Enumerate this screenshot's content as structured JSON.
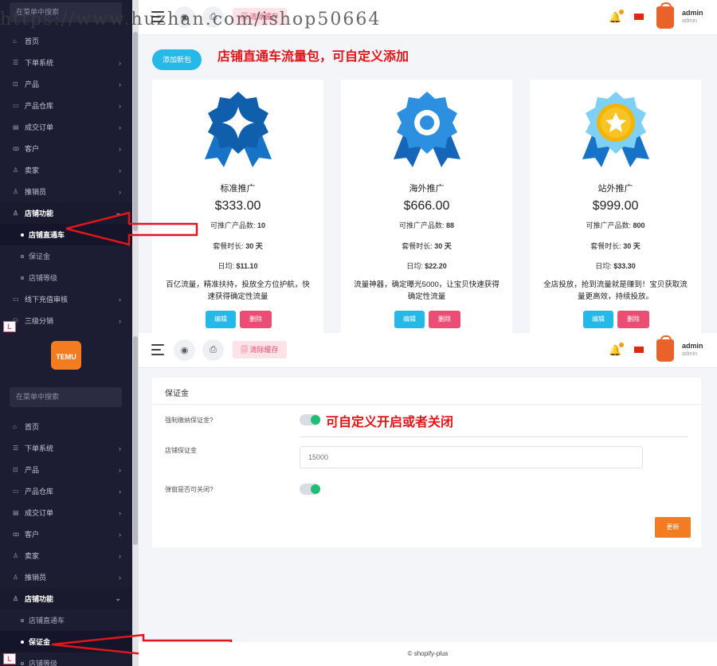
{
  "watermark": "https://www.huzhan.com/ishop50664",
  "header": {
    "clear_cache": "清除缓存",
    "user_name": "admin",
    "user_role": "admin"
  },
  "sidebar": {
    "search_placeholder": "在菜单中搜索",
    "brand_logo": "TEMU",
    "items": [
      {
        "label": "首页",
        "icon": "home-icon"
      },
      {
        "label": "下单系统",
        "icon": "list-icon"
      },
      {
        "label": "产品",
        "icon": "cart-icon"
      },
      {
        "label": "产品仓库",
        "icon": "warehouse-icon"
      },
      {
        "label": "成交订单",
        "icon": "order-icon"
      },
      {
        "label": "客户",
        "icon": "users-icon"
      },
      {
        "label": "卖家",
        "icon": "user-icon"
      },
      {
        "label": "推销员",
        "icon": "user-icon"
      },
      {
        "label": "店铺功能",
        "icon": "user-icon"
      }
    ],
    "shop_sub": [
      "店铺直通车",
      "保证金",
      "店铺等级"
    ],
    "extra_items": [
      {
        "label": "线下充值审核",
        "icon": "card-icon"
      },
      {
        "label": "三级分销",
        "icon": "share-icon"
      }
    ]
  },
  "promo": {
    "add_button": "添加新包",
    "annotation": "店铺直通车流量包，可自定义添加",
    "count_label": "可推广产品数:",
    "duration_label": "套餐时长:",
    "daily_label": "日均:",
    "edit": "编辑",
    "delete": "删除",
    "cards": [
      {
        "name": "标准推广",
        "price": "$333.00",
        "count": "10",
        "duration": "30 天",
        "daily": "$11.10",
        "desc": "百亿流量，精准扶持，投放全方位护航，快速获得确定性流量"
      },
      {
        "name": "海外推广",
        "price": "$666.00",
        "count": "88",
        "duration": "30 天",
        "daily": "$22.20",
        "desc": "流量神器，确定曝光5000，让宝贝快速获得确定性流量"
      },
      {
        "name": "站外推广",
        "price": "$999.00",
        "count": "800",
        "duration": "30 天",
        "daily": "$33.30",
        "desc": "全店投放，抢到流量就是赚到！宝贝获取流量更高效，持续投放。"
      }
    ]
  },
  "deposit": {
    "title": "保证金",
    "annotation": "可自定义开启或者关闭",
    "force_label": "强制缴纳保证金?",
    "amount_label": "店铺保证金",
    "amount_value": "15000",
    "closable_label": "弹窗是否可关闭?",
    "save": "更新",
    "footer": "© shopify-plus"
  },
  "colors": {
    "sidebar_bg": "#1c1d33",
    "accent_blue": "#25b9ea",
    "delete_pink": "#ec4d74",
    "save_orange": "#f47c20",
    "toggle_green": "#1dbf73",
    "annotation_red": "#e0161a"
  }
}
